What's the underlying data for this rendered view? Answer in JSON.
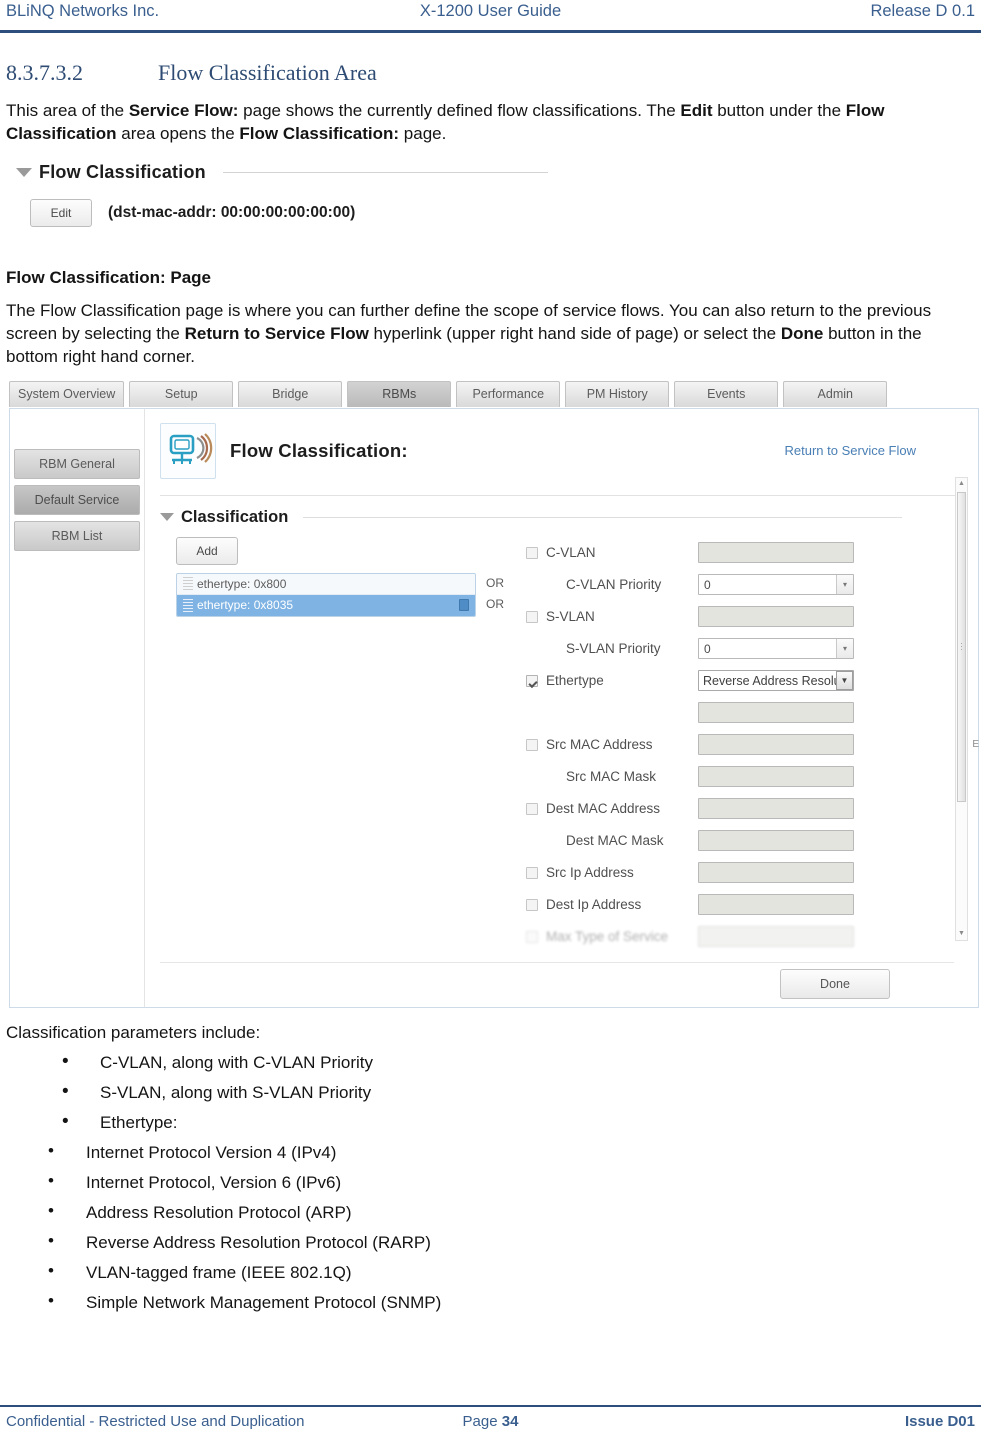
{
  "header": {
    "left": "BLiNQ Networks Inc.",
    "center": "X-1200 User Guide",
    "right": "Release D 0.1"
  },
  "section": {
    "number": "8.3.7.3.2",
    "title": "Flow Classification Area",
    "intro_1": "This area of the ",
    "intro_b1": "Service Flow:",
    "intro_2": " page shows the currently defined flow classifications. The ",
    "intro_b2": "Edit",
    "intro_3": " button under the ",
    "intro_b3": "Flow Classification",
    "intro_4": " area opens the ",
    "intro_b4": "Flow Classification:",
    "intro_5": " page."
  },
  "figure1": {
    "panel_title": "Flow Classification",
    "edit_label": "Edit",
    "meta": "(dst-mac-addr: 00:00:00:00:00:00)"
  },
  "subheading": "Flow Classification: Page",
  "paragraph2": {
    "p1": "The Flow Classification page is where you can further define the scope of service flows. You can also return to the previous screen by selecting the ",
    "b1": "Return to Service Flow",
    "p2": " hyperlink (upper right hand side of page) or select the ",
    "b2": "Done",
    "p3": " button in the bottom right hand corner."
  },
  "figure2": {
    "tabs": [
      {
        "label": "System Overview",
        "active": false
      },
      {
        "label": "Setup",
        "active": false
      },
      {
        "label": "Bridge",
        "active": false
      },
      {
        "label": "RBMs",
        "active": true
      },
      {
        "label": "Performance",
        "active": false
      },
      {
        "label": "PM History",
        "active": false
      },
      {
        "label": "Events",
        "active": false
      },
      {
        "label": "Admin",
        "active": false
      }
    ],
    "sidebar": [
      {
        "label": "RBM General",
        "active": false
      },
      {
        "label": "Default Service",
        "active": true
      },
      {
        "label": "RBM List",
        "active": false
      }
    ],
    "page_title": "Flow Classification:",
    "return_link": "Return to Service Flow",
    "panel_title": "Classification",
    "add_label": "Add",
    "class_rows": [
      {
        "text": "ethertype: 0x800",
        "selected": false,
        "or": "OR"
      },
      {
        "text": "ethertype: 0x8035",
        "selected": true,
        "or": "OR"
      }
    ],
    "fields": [
      {
        "label": "C-VLAN",
        "checkbox": true,
        "checked": false,
        "type": "text",
        "value": "",
        "indent": false
      },
      {
        "label": "C-VLAN Priority",
        "checkbox": false,
        "checked": false,
        "type": "spin",
        "value": "0",
        "indent": true
      },
      {
        "label": "S-VLAN",
        "checkbox": true,
        "checked": false,
        "type": "text",
        "value": "",
        "indent": false
      },
      {
        "label": "S-VLAN Priority",
        "checkbox": false,
        "checked": false,
        "type": "spin",
        "value": "0",
        "indent": true
      },
      {
        "label": "Ethertype",
        "checkbox": true,
        "checked": true,
        "type": "select",
        "value": "Reverse Address Resolutio",
        "indent": false
      },
      {
        "label": "",
        "checkbox": false,
        "checked": false,
        "type": "text",
        "value": "",
        "indent": true
      },
      {
        "label": "Src MAC Address",
        "checkbox": true,
        "checked": false,
        "type": "text",
        "value": "",
        "indent": false
      },
      {
        "label": "Src MAC Mask",
        "checkbox": false,
        "checked": false,
        "type": "text",
        "value": "",
        "indent": true
      },
      {
        "label": "Dest MAC Address",
        "checkbox": true,
        "checked": false,
        "type": "text",
        "value": "",
        "indent": false
      },
      {
        "label": "Dest MAC Mask",
        "checkbox": false,
        "checked": false,
        "type": "text",
        "value": "",
        "indent": true
      },
      {
        "label": "Src Ip Address",
        "checkbox": true,
        "checked": false,
        "type": "text",
        "value": "",
        "indent": false
      },
      {
        "label": "Dest Ip Address",
        "checkbox": true,
        "checked": false,
        "type": "text",
        "value": "",
        "indent": false
      },
      {
        "label": "Max Type of Service",
        "checkbox": true,
        "checked": false,
        "type": "text",
        "value": "",
        "indent": false,
        "clipped": true
      }
    ],
    "scroll_marker": "E",
    "done_label": "Done"
  },
  "list": {
    "lead": "Classification parameters include:",
    "items": [
      "C-VLAN, along with C-VLAN Priority",
      "S-VLAN, along with S-VLAN Priority",
      "Ethertype:"
    ],
    "sub_items": [
      "Internet Protocol Version 4 (IPv4)",
      "Internet Protocol, Version 6 (IPv6)",
      "Address Resolution Protocol (ARP)",
      "Reverse Address Resolution Protocol (RARP)",
      "VLAN-tagged frame (IEEE 802.1Q)",
      "Simple Network Management Protocol (SNMP)"
    ]
  },
  "footer": {
    "left": "Confidential - Restricted Use and Duplication",
    "page_label": "Page ",
    "page_number": "34",
    "right": "Issue D01"
  },
  "colors": {
    "accent_blue": "#2e4e7e",
    "heading_blue": "#2e4b73",
    "link_blue": "#4a7fb5",
    "selection_blue": "#7eb3e3"
  }
}
